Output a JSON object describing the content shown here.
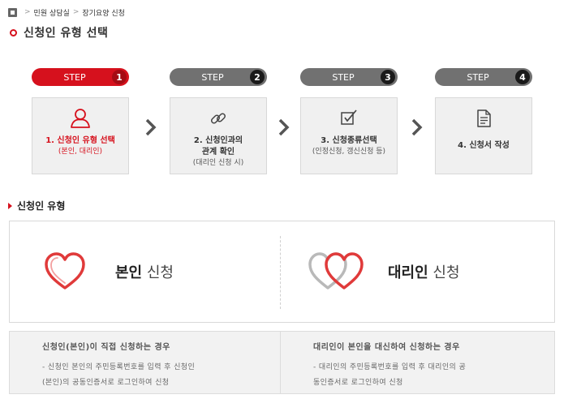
{
  "breadcrumb": {
    "items": [
      "민원 상담실",
      "장기요양 신청"
    ]
  },
  "page_title": "신청인 유형 선택",
  "steps": [
    {
      "label": "STEP",
      "number": "1",
      "title_line1": "1. 신청인 유형 선택",
      "title_line2": "",
      "sub": "(본인, 대리인)",
      "icon": "person-icon",
      "active": true
    },
    {
      "label": "STEP",
      "number": "2",
      "title_line1": "2. 신청인과의",
      "title_line2": "관계 확인",
      "sub": "(대리인 신청 시)",
      "icon": "link-icon",
      "active": false
    },
    {
      "label": "STEP",
      "number": "3",
      "title_line1": "3. 신청종류선택",
      "title_line2": "",
      "sub": "(인정신청, 갱신신청 등)",
      "icon": "checkbox-icon",
      "active": false
    },
    {
      "label": "STEP",
      "number": "4",
      "title_line1": "4. 신청서 작성",
      "title_line2": "",
      "sub": "",
      "icon": "document-icon",
      "active": false
    }
  ],
  "section_title": "신청인 유형",
  "types": {
    "self": {
      "bold": "본인",
      "normal": " 신청",
      "icon": "heart-icon"
    },
    "proxy": {
      "bold": "대리인",
      "normal": " 신청",
      "icon": "double-heart-icon"
    }
  },
  "descriptions": {
    "self": {
      "heading": "신청인(본인)이 직접 신청하는 경우",
      "line1": "- 신청인 본인의 주민등록번호를 입력 후 신청인",
      "line2": "(본인)의 공동인증서로 로그인하여 신청"
    },
    "proxy": {
      "heading": "대리인이 본인을 대신하여 신청하는 경우",
      "line1": "- 대리인의 주민등록번호를 입력 후 대리인의 공",
      "line2": "동인증서로 로그인하여 신청"
    }
  },
  "colors": {
    "accent": "#d6111d",
    "step_inactive": "#717171",
    "step_number_inactive": "#1a1a1a",
    "box_bg": "#f0f0f0"
  }
}
